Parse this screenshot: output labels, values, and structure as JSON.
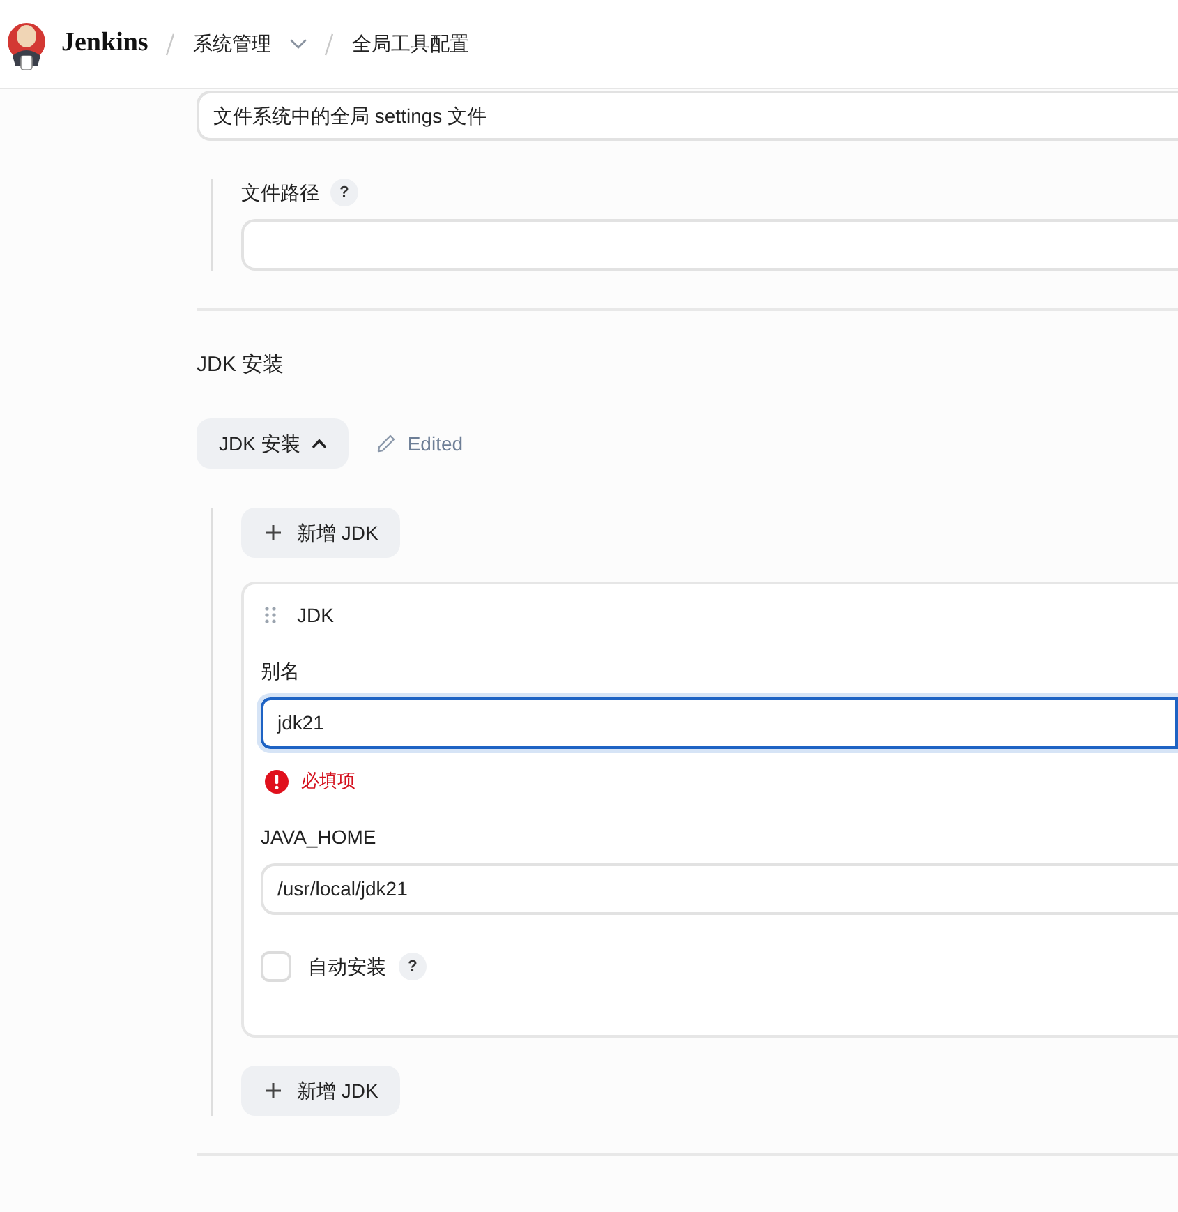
{
  "header": {
    "title": "Jenkins",
    "breadcrumbs": [
      {
        "label": "系统管理",
        "dropdown": true
      },
      {
        "label": "全局工具配置",
        "dropdown": false
      }
    ]
  },
  "settings_file": {
    "select": {
      "value": "文件系统中的全局 settings 文件"
    },
    "file_path": {
      "label": "文件路径",
      "help": "?"
    }
  },
  "jdk_section": {
    "title": "JDK 安装",
    "toggle": {
      "label": "JDK 安装",
      "expanded": true
    },
    "status": "Edited",
    "add_top": {
      "label": "新增 JDK"
    },
    "installations": [
      {
        "title": "JDK",
        "fields": [
          {
            "kind": "text",
            "label": "别名",
            "value": "jdk21",
            "focused": true,
            "error": "必填项"
          },
          {
            "kind": "text",
            "label": "JAVA_HOME",
            "value": "/usr/local/jdk21",
            "focused": false
          },
          {
            "kind": "checkbox",
            "label": "自动安装",
            "checked": false,
            "help": "?"
          }
        ]
      }
    ],
    "add_bottom": {
      "label": "新增 JDK"
    }
  }
}
